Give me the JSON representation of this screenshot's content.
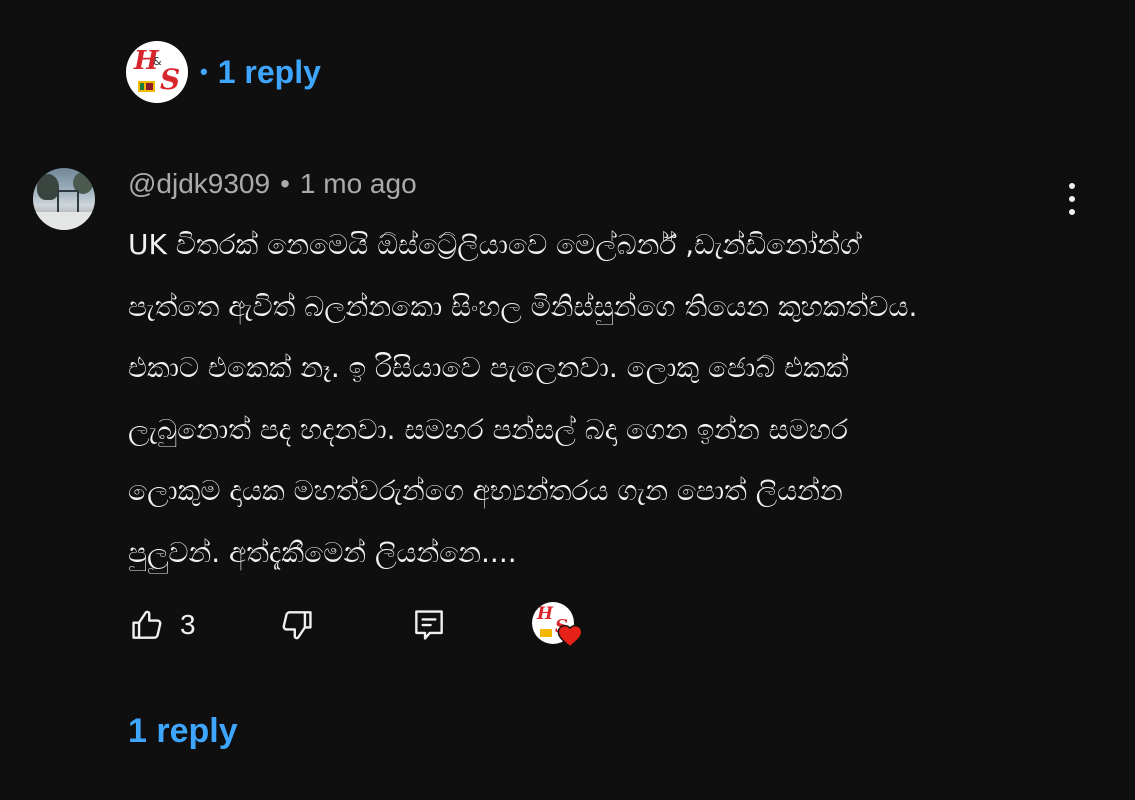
{
  "top_thread": {
    "separator": "•",
    "reply_label": "1 reply"
  },
  "comment": {
    "author": "@djdk9309",
    "separator": "•",
    "time": "1 mo ago",
    "lines": [
      "UK විතරක් නෙමෙයි ඕස්ට්‍රේලියාවෙ මෙල්බර්න් ,ඩැන්ඩිනෝන්ග්",
      "පැත්තෙ ඇවිත් බලන්නකො සිංහල මිනිස්සුන්ගෙ තියෙන කුහකත්වය.",
      "එකාට එකෙක් නෑ. ඉ රිසියාවෙ පැලෙනවා. ලොකු ජොබ් එකක්",
      "ලැබුනොත් පද හදනවා. සමහර පන්සල් බදා ගෙන ඉන්න සමහර",
      "ලොකුම දායක මහත්වරුන්ගෙ අභ්‍යන්තරය ගැන පොත් ලියන්න",
      "පුලුවන්. අත්දැකීමෙන් ලියන්නෙ...."
    ],
    "like_count": "3"
  },
  "bottom_reply": {
    "label": "1 reply"
  },
  "icons": {
    "more": "more-vert-icon",
    "like": "thumb-up-icon",
    "dislike": "thumb-down-icon",
    "reply": "comment-reply-icon",
    "heart": "creator-heart-icon"
  },
  "colors": {
    "background": "#0f0f0f",
    "link": "#3ea6ff",
    "text": "#f1f1f1",
    "meta": "#aaaaaa",
    "heart": "#e62117"
  }
}
